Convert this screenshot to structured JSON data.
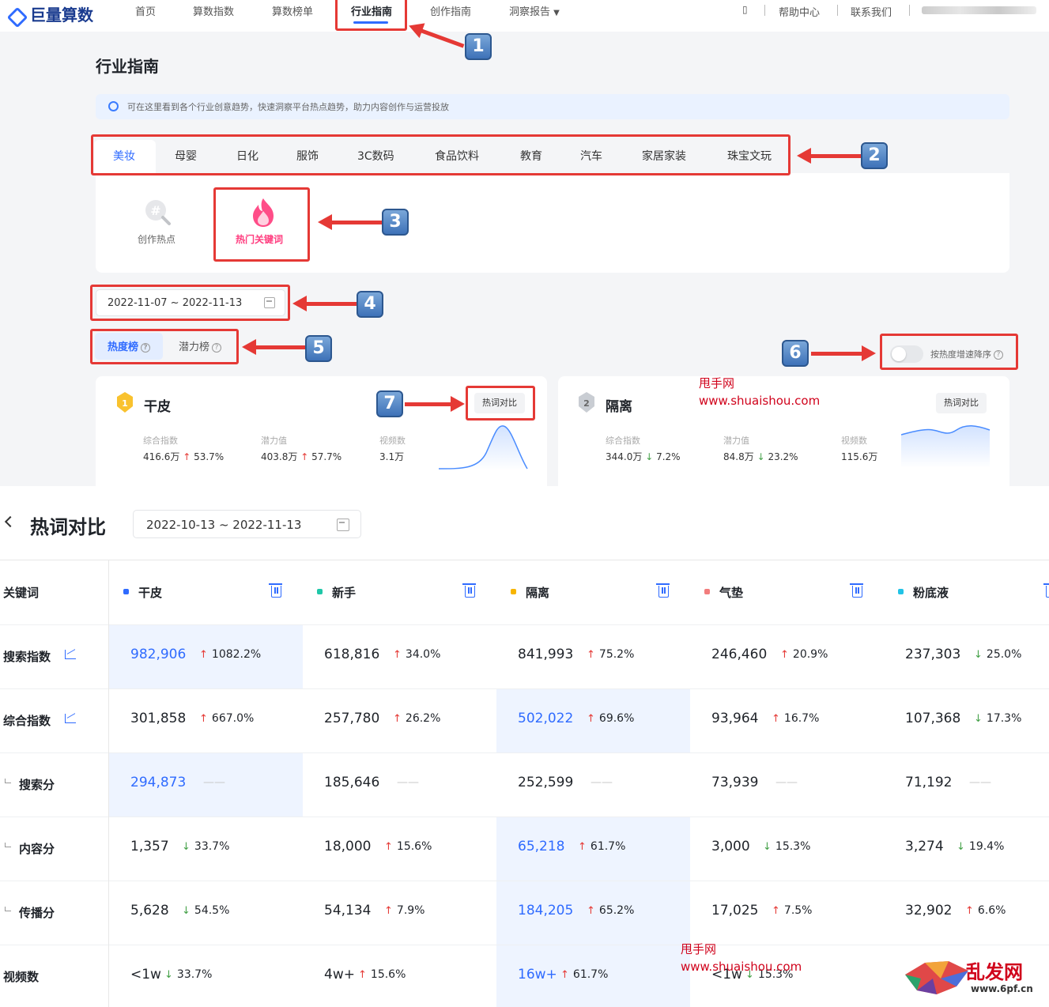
{
  "nav": {
    "brand": "巨量算数",
    "items": [
      "首页",
      "算数指数",
      "算数榜单",
      "行业指南",
      "创作指南",
      "洞察报告"
    ],
    "active": "行业指南",
    "right": [
      "帮助中心",
      "联系我们"
    ]
  },
  "page": {
    "title": "行业指南",
    "tip": "可在这里看到各个行业创意趋势，快速洞察平台热点趋势，助力内容创作与运营投放"
  },
  "categories": [
    "美妆",
    "母婴",
    "日化",
    "服饰",
    "3C数码",
    "食品饮料",
    "教育",
    "汽车",
    "家居家装",
    "珠宝文玩"
  ],
  "active_category": "美妆",
  "sub_tabs": [
    "创作热点",
    "热门关键词"
  ],
  "date_range": "2022-11-07 ~ 2022-11-13",
  "rank_tabs": [
    "热度榜",
    "潜力榜"
  ],
  "toggle_label": "按热度增速降序",
  "cards": [
    {
      "rank": "1",
      "name": "干皮",
      "compare": "热词对比",
      "metrics": [
        {
          "label": "综合指数",
          "value": "416.6万",
          "change": "53.7%",
          "dir": "up"
        },
        {
          "label": "潜力值",
          "value": "403.8万",
          "change": "57.7%",
          "dir": "up"
        },
        {
          "label": "视频数",
          "value": "3.1万",
          "change": "",
          "dir": ""
        }
      ]
    },
    {
      "rank": "2",
      "name": "隔离",
      "compare": "热词对比",
      "metrics": [
        {
          "label": "综合指数",
          "value": "344.0万",
          "change": "7.2%",
          "dir": "down"
        },
        {
          "label": "潜力值",
          "value": "84.8万",
          "change": "23.2%",
          "dir": "down"
        },
        {
          "label": "视频数",
          "value": "115.6万",
          "change": "",
          "dir": ""
        }
      ]
    }
  ],
  "callouts": [
    "1",
    "2",
    "3",
    "4",
    "5",
    "6",
    "7"
  ],
  "watermarks": [
    {
      "line1": "甩手网",
      "line2": "www.shuaishou.com"
    },
    {
      "line1": "甩手网",
      "line2": "www.shuaishou.com"
    }
  ],
  "compare": {
    "title": "热词对比",
    "date_range": "2022-10-13 ~ 2022-11-13",
    "first_col": "关键词",
    "keywords": [
      {
        "name": "干皮",
        "color": "#2f6bff"
      },
      {
        "name": "新手",
        "color": "#1fc7a8"
      },
      {
        "name": "隔离",
        "color": "#f7b500"
      },
      {
        "name": "气垫",
        "color": "#f27d7d"
      },
      {
        "name": "粉底液",
        "color": "#22c3e6"
      }
    ],
    "rows": [
      {
        "label": "搜索指数",
        "sub": false,
        "trend": true,
        "hi": 0,
        "cells": [
          [
            "982,906",
            "u",
            "1082.2%"
          ],
          [
            "618,816",
            "u",
            "34.0%"
          ],
          [
            "841,993",
            "u",
            "75.2%"
          ],
          [
            "246,460",
            "u",
            "20.9%"
          ],
          [
            "237,303",
            "d",
            "25.0%"
          ]
        ]
      },
      {
        "label": "综合指数",
        "sub": false,
        "trend": true,
        "hi": 2,
        "cells": [
          [
            "301,858",
            "u",
            "667.0%"
          ],
          [
            "257,780",
            "u",
            "26.2%"
          ],
          [
            "502,022",
            "u",
            "69.6%"
          ],
          [
            "93,964",
            "u",
            "16.7%"
          ],
          [
            "107,368",
            "d",
            "17.3%"
          ]
        ]
      },
      {
        "label": "搜索分",
        "sub": true,
        "trend": false,
        "hi": 0,
        "cells": [
          [
            "294,873",
            "n",
            "——"
          ],
          [
            "185,646",
            "n",
            "——"
          ],
          [
            "252,599",
            "n",
            "——"
          ],
          [
            "73,939",
            "n",
            "——"
          ],
          [
            "71,192",
            "n",
            "——"
          ]
        ]
      },
      {
        "label": "内容分",
        "sub": true,
        "trend": false,
        "hi": 2,
        "cells": [
          [
            "1,357",
            "d",
            "33.7%"
          ],
          [
            "18,000",
            "u",
            "15.6%"
          ],
          [
            "65,218",
            "u",
            "61.7%"
          ],
          [
            "3,000",
            "d",
            "15.3%"
          ],
          [
            "3,274",
            "d",
            "19.4%"
          ]
        ]
      },
      {
        "label": "传播分",
        "sub": true,
        "trend": false,
        "hi": 2,
        "cells": [
          [
            "5,628",
            "d",
            "54.5%"
          ],
          [
            "54,134",
            "u",
            "7.9%"
          ],
          [
            "184,205",
            "u",
            "65.2%"
          ],
          [
            "17,025",
            "u",
            "7.5%"
          ],
          [
            "32,902",
            "u",
            "6.6%"
          ]
        ]
      },
      {
        "label": "视频数",
        "sub": false,
        "trend": false,
        "hi": 2,
        "cells": [
          [
            "<1w",
            "d",
            "33.7%"
          ],
          [
            "4w+",
            "u",
            "15.6%"
          ],
          [
            "16w+",
            "u",
            "61.7%"
          ],
          [
            "<1w",
            "d",
            "15.3%"
          ],
          [
            "",
            "",
            " "
          ]
        ]
      }
    ]
  },
  "corner_logo": {
    "text": "乱发网",
    "url": "www.6pf.cn"
  }
}
